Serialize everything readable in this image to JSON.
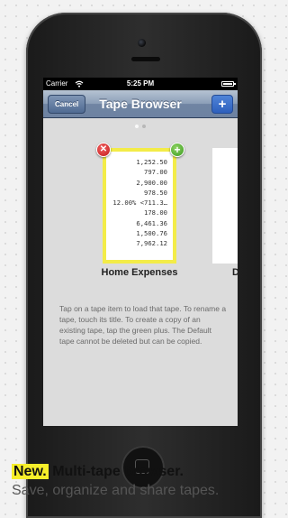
{
  "status_bar": {
    "carrier": "Carrier",
    "time": "5:25 PM"
  },
  "nav_bar": {
    "title": "Tape Browser",
    "cancel_label": "Cancel",
    "add_label": "+"
  },
  "pager": {
    "pages": 2,
    "active": 0
  },
  "tapes": [
    {
      "title": "Home Expenses",
      "lines": [
        "1,252.50",
        "797.00",
        "2,900.00",
        "978.50",
        "12.00% <711.3…",
        "178.00",
        "6,461.36",
        "1,500.76",
        "7,962.12"
      ]
    },
    {
      "title": "D"
    }
  ],
  "delete_glyph": "✕",
  "add_copy_glyph": "+",
  "help_text": "Tap on a tape item to load that tape. To rename a tape, touch its title. To create a copy of an existing tape, tap the green plus. The Default tape cannot be deleted but can be copied.",
  "promo": {
    "highlight": "New.",
    "headline": " Multi-tape browser.",
    "subline": "Save, organize and share tapes."
  },
  "colors": {
    "highlight": "#f7ef2a",
    "tape_border": "#f3ec48",
    "nav_bar": "#7f93b0"
  }
}
